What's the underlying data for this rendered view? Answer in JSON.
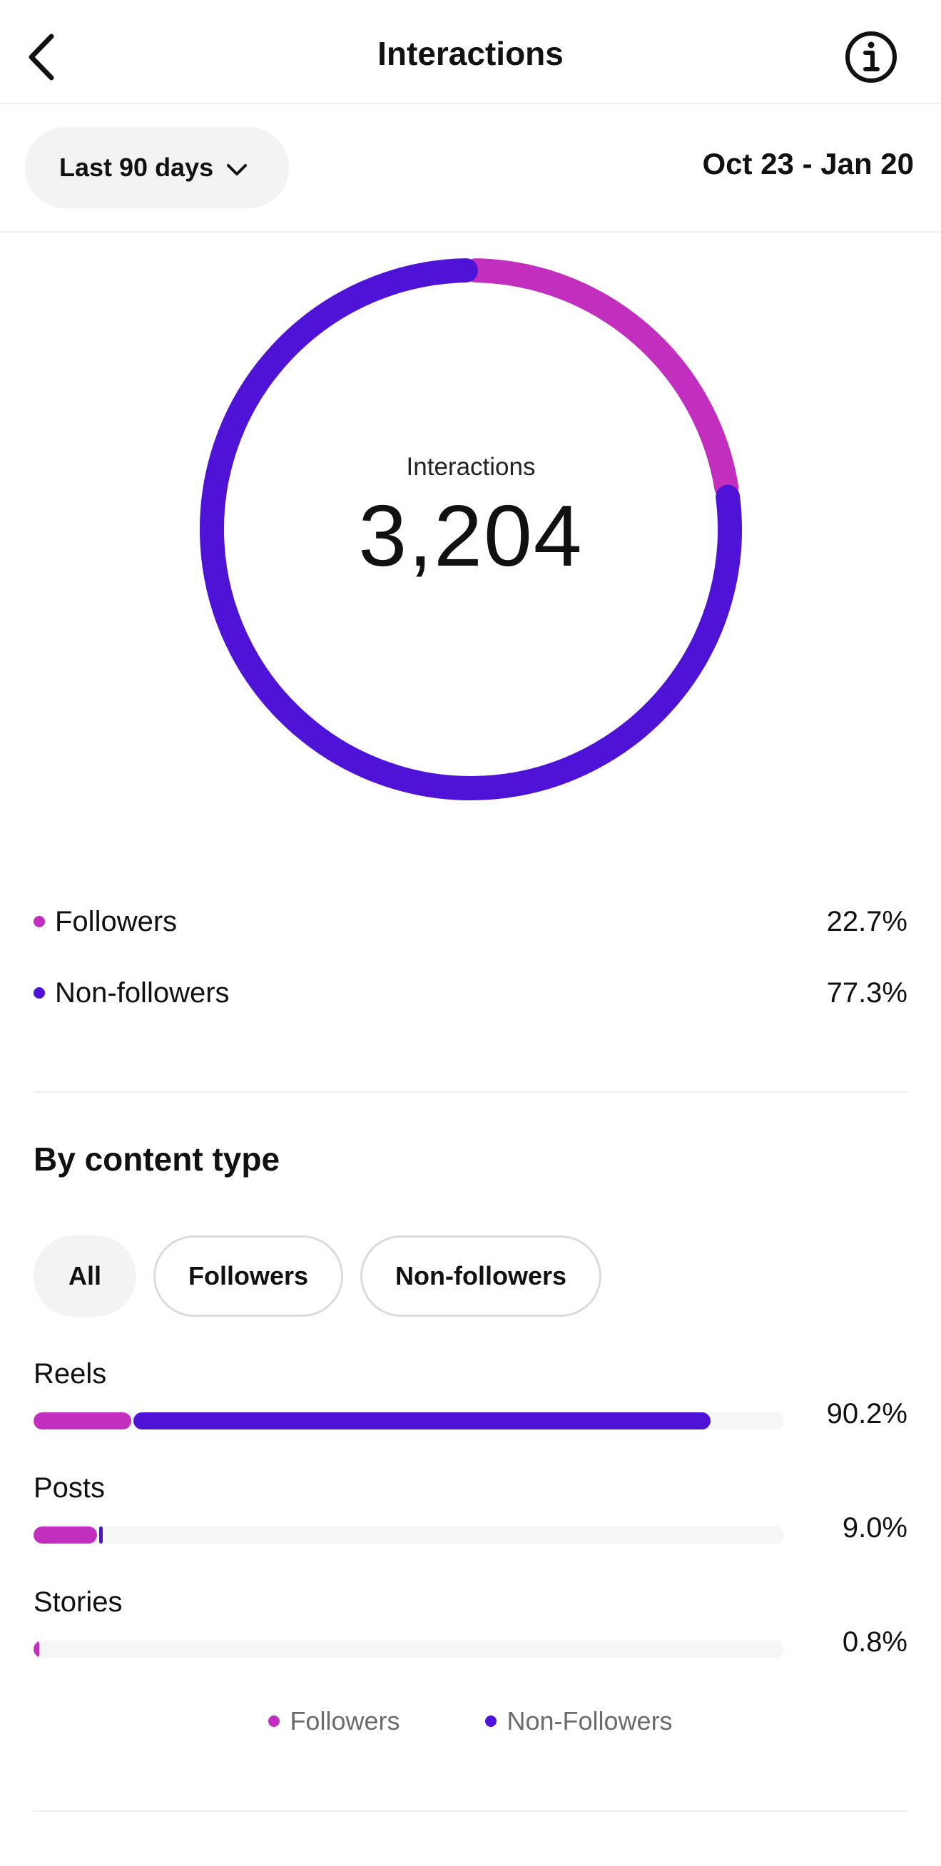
{
  "header": {
    "title": "Interactions",
    "back_icon": "chevron-left-icon",
    "info_icon": "info-icon"
  },
  "filter": {
    "range_label": "Last 90 days",
    "range_chevron_icon": "chevron-down-icon",
    "date_range": "Oct 23 - Jan 20"
  },
  "colors": {
    "followers": "#c22fbf",
    "non_followers": "#4f13d8",
    "track": "#f6f6f6"
  },
  "donut": {
    "label": "Interactions",
    "value": "3,204"
  },
  "chart_data": [
    {
      "type": "pie",
      "categories": [
        "Followers",
        "Non-followers"
      ],
      "values": [
        22.7,
        77.3
      ],
      "title": "Interactions"
    },
    {
      "type": "bar",
      "categories": [
        "Reels",
        "Posts",
        "Stories"
      ],
      "series": [
        {
          "name": "Followers",
          "values": [
            13.0,
            8.5,
            0.8
          ]
        },
        {
          "name": "Non-Followers",
          "values": [
            77.2,
            0.5,
            0.0
          ]
        }
      ],
      "totals": [
        "90.2%",
        "9.0%",
        "0.8%"
      ],
      "ylim": [
        0,
        100
      ]
    }
  ],
  "legend": [
    {
      "label": "Followers",
      "pct": "22.7%"
    },
    {
      "label": "Non-followers",
      "pct": "77.3%"
    }
  ],
  "content_type": {
    "title": "By content type",
    "chips": [
      "All",
      "Followers",
      "Non-followers"
    ],
    "active_chip": "All",
    "bars": [
      {
        "label": "Reels",
        "pct": "90.2%"
      },
      {
        "label": "Posts",
        "pct": "9.0%"
      },
      {
        "label": "Stories",
        "pct": "0.8%"
      }
    ],
    "legend": [
      "Followers",
      "Non-Followers"
    ]
  }
}
